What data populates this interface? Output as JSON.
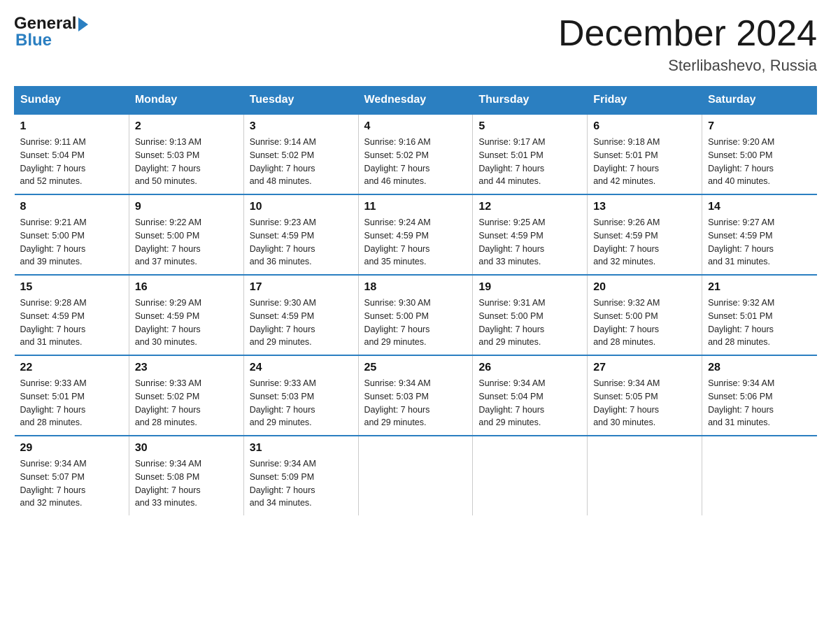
{
  "header": {
    "logo_general": "General",
    "logo_arrow": "▶",
    "logo_blue": "Blue",
    "title": "December 2024",
    "location": "Sterlibashevo, Russia"
  },
  "days_of_week": [
    "Sunday",
    "Monday",
    "Tuesday",
    "Wednesday",
    "Thursday",
    "Friday",
    "Saturday"
  ],
  "weeks": [
    [
      {
        "num": "1",
        "info": "Sunrise: 9:11 AM\nSunset: 5:04 PM\nDaylight: 7 hours\nand 52 minutes."
      },
      {
        "num": "2",
        "info": "Sunrise: 9:13 AM\nSunset: 5:03 PM\nDaylight: 7 hours\nand 50 minutes."
      },
      {
        "num": "3",
        "info": "Sunrise: 9:14 AM\nSunset: 5:02 PM\nDaylight: 7 hours\nand 48 minutes."
      },
      {
        "num": "4",
        "info": "Sunrise: 9:16 AM\nSunset: 5:02 PM\nDaylight: 7 hours\nand 46 minutes."
      },
      {
        "num": "5",
        "info": "Sunrise: 9:17 AM\nSunset: 5:01 PM\nDaylight: 7 hours\nand 44 minutes."
      },
      {
        "num": "6",
        "info": "Sunrise: 9:18 AM\nSunset: 5:01 PM\nDaylight: 7 hours\nand 42 minutes."
      },
      {
        "num": "7",
        "info": "Sunrise: 9:20 AM\nSunset: 5:00 PM\nDaylight: 7 hours\nand 40 minutes."
      }
    ],
    [
      {
        "num": "8",
        "info": "Sunrise: 9:21 AM\nSunset: 5:00 PM\nDaylight: 7 hours\nand 39 minutes."
      },
      {
        "num": "9",
        "info": "Sunrise: 9:22 AM\nSunset: 5:00 PM\nDaylight: 7 hours\nand 37 minutes."
      },
      {
        "num": "10",
        "info": "Sunrise: 9:23 AM\nSunset: 4:59 PM\nDaylight: 7 hours\nand 36 minutes."
      },
      {
        "num": "11",
        "info": "Sunrise: 9:24 AM\nSunset: 4:59 PM\nDaylight: 7 hours\nand 35 minutes."
      },
      {
        "num": "12",
        "info": "Sunrise: 9:25 AM\nSunset: 4:59 PM\nDaylight: 7 hours\nand 33 minutes."
      },
      {
        "num": "13",
        "info": "Sunrise: 9:26 AM\nSunset: 4:59 PM\nDaylight: 7 hours\nand 32 minutes."
      },
      {
        "num": "14",
        "info": "Sunrise: 9:27 AM\nSunset: 4:59 PM\nDaylight: 7 hours\nand 31 minutes."
      }
    ],
    [
      {
        "num": "15",
        "info": "Sunrise: 9:28 AM\nSunset: 4:59 PM\nDaylight: 7 hours\nand 31 minutes."
      },
      {
        "num": "16",
        "info": "Sunrise: 9:29 AM\nSunset: 4:59 PM\nDaylight: 7 hours\nand 30 minutes."
      },
      {
        "num": "17",
        "info": "Sunrise: 9:30 AM\nSunset: 4:59 PM\nDaylight: 7 hours\nand 29 minutes."
      },
      {
        "num": "18",
        "info": "Sunrise: 9:30 AM\nSunset: 5:00 PM\nDaylight: 7 hours\nand 29 minutes."
      },
      {
        "num": "19",
        "info": "Sunrise: 9:31 AM\nSunset: 5:00 PM\nDaylight: 7 hours\nand 29 minutes."
      },
      {
        "num": "20",
        "info": "Sunrise: 9:32 AM\nSunset: 5:00 PM\nDaylight: 7 hours\nand 28 minutes."
      },
      {
        "num": "21",
        "info": "Sunrise: 9:32 AM\nSunset: 5:01 PM\nDaylight: 7 hours\nand 28 minutes."
      }
    ],
    [
      {
        "num": "22",
        "info": "Sunrise: 9:33 AM\nSunset: 5:01 PM\nDaylight: 7 hours\nand 28 minutes."
      },
      {
        "num": "23",
        "info": "Sunrise: 9:33 AM\nSunset: 5:02 PM\nDaylight: 7 hours\nand 28 minutes."
      },
      {
        "num": "24",
        "info": "Sunrise: 9:33 AM\nSunset: 5:03 PM\nDaylight: 7 hours\nand 29 minutes."
      },
      {
        "num": "25",
        "info": "Sunrise: 9:34 AM\nSunset: 5:03 PM\nDaylight: 7 hours\nand 29 minutes."
      },
      {
        "num": "26",
        "info": "Sunrise: 9:34 AM\nSunset: 5:04 PM\nDaylight: 7 hours\nand 29 minutes."
      },
      {
        "num": "27",
        "info": "Sunrise: 9:34 AM\nSunset: 5:05 PM\nDaylight: 7 hours\nand 30 minutes."
      },
      {
        "num": "28",
        "info": "Sunrise: 9:34 AM\nSunset: 5:06 PM\nDaylight: 7 hours\nand 31 minutes."
      }
    ],
    [
      {
        "num": "29",
        "info": "Sunrise: 9:34 AM\nSunset: 5:07 PM\nDaylight: 7 hours\nand 32 minutes."
      },
      {
        "num": "30",
        "info": "Sunrise: 9:34 AM\nSunset: 5:08 PM\nDaylight: 7 hours\nand 33 minutes."
      },
      {
        "num": "31",
        "info": "Sunrise: 9:34 AM\nSunset: 5:09 PM\nDaylight: 7 hours\nand 34 minutes."
      },
      null,
      null,
      null,
      null
    ]
  ]
}
